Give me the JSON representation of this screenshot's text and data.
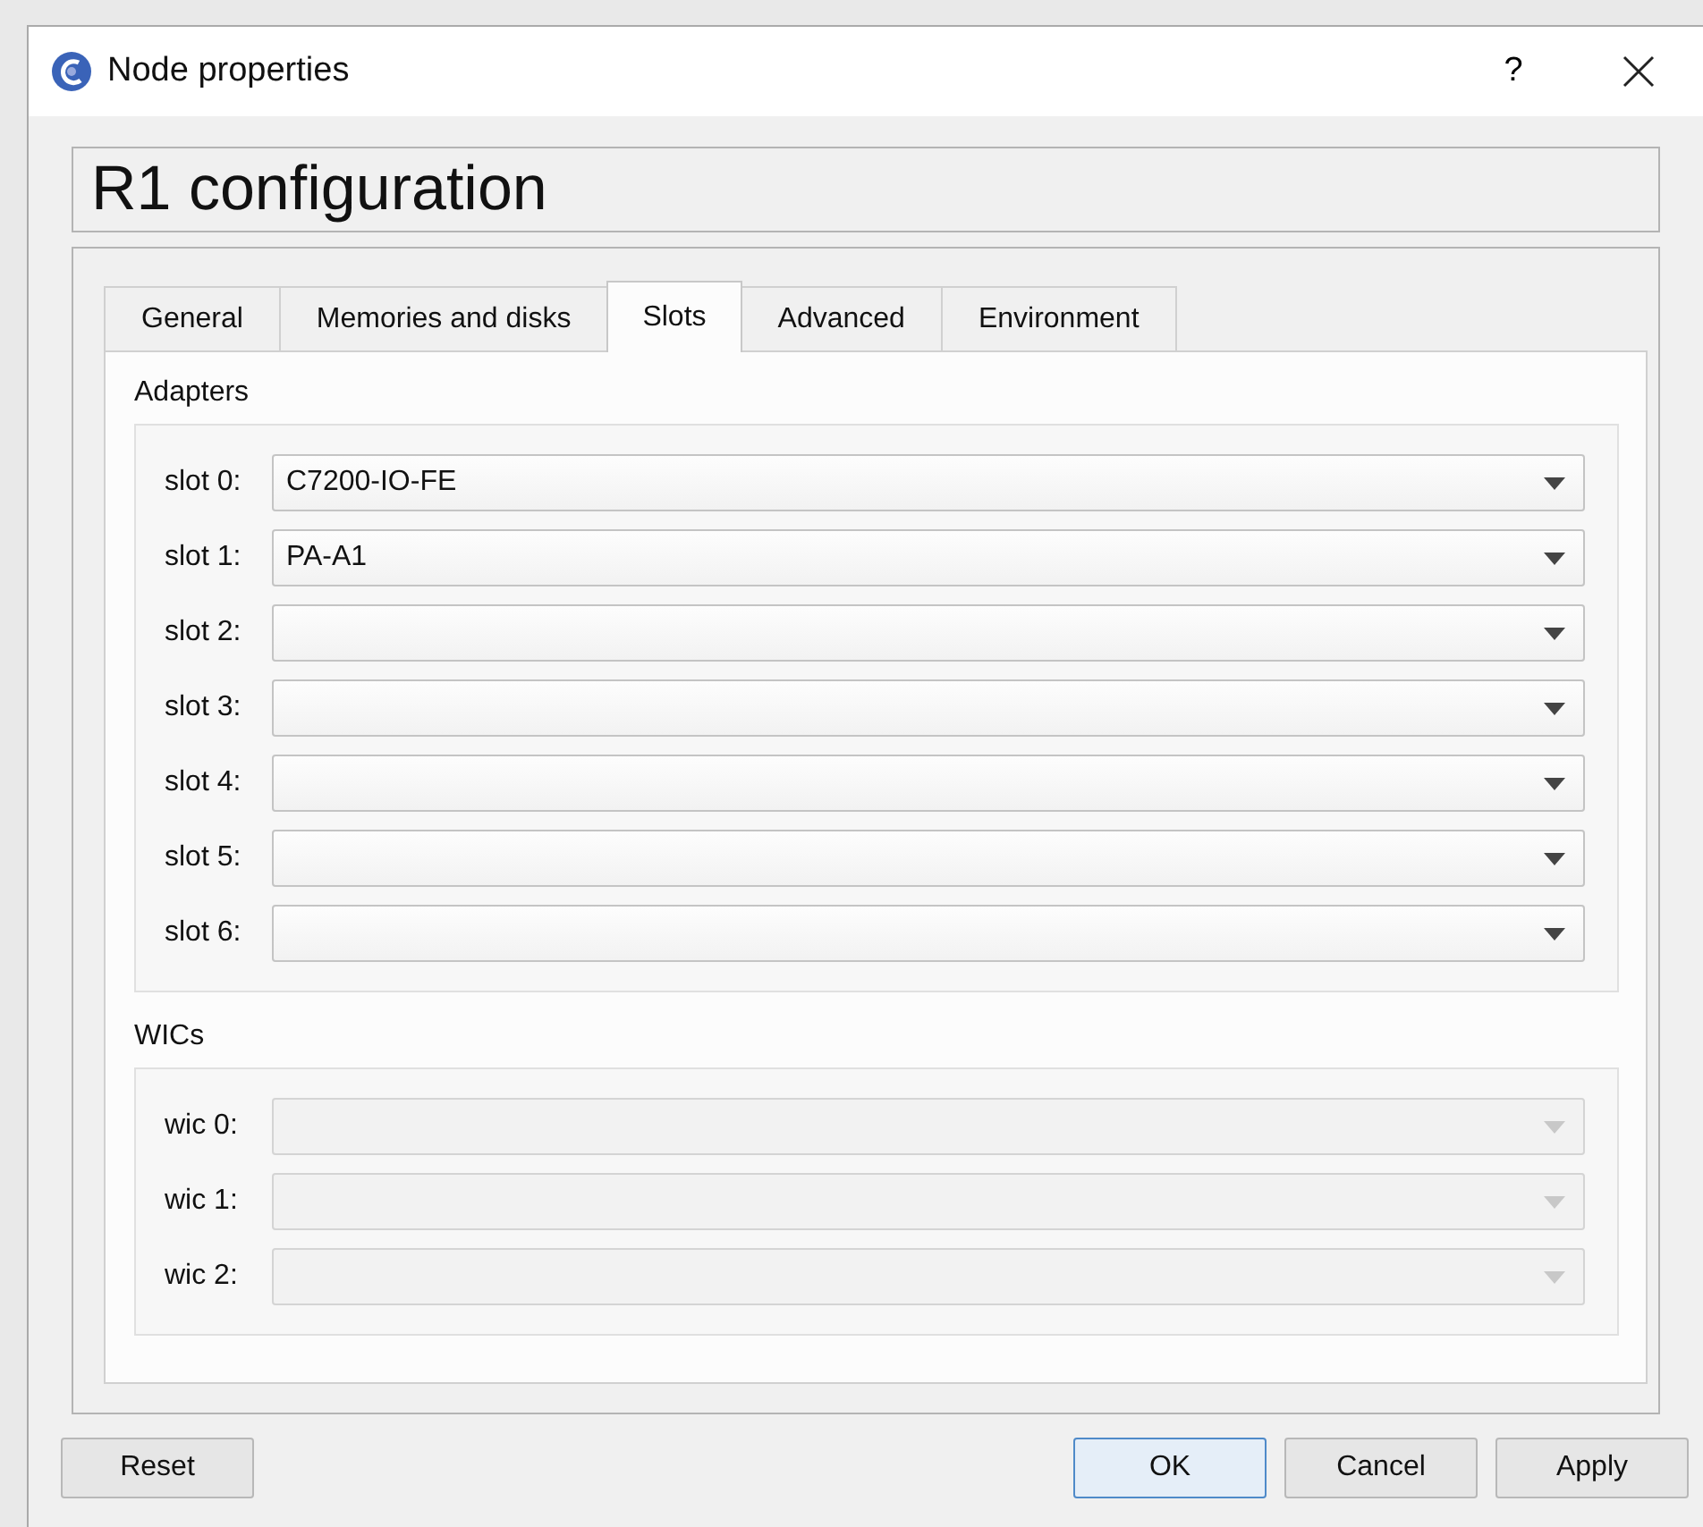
{
  "window": {
    "title": "Node properties",
    "help": "?"
  },
  "header": {
    "title": "R1 configuration"
  },
  "tabs": [
    {
      "label": "General",
      "selected": false
    },
    {
      "label": "Memories and disks",
      "selected": false
    },
    {
      "label": "Slots",
      "selected": true
    },
    {
      "label": "Advanced",
      "selected": false
    },
    {
      "label": "Environment",
      "selected": false
    }
  ],
  "groups": [
    {
      "title": "Adapters",
      "rows": [
        {
          "label": "slot 0:",
          "value": "C7200-IO-FE",
          "disabled": false
        },
        {
          "label": "slot 1:",
          "value": "PA-A1",
          "disabled": false
        },
        {
          "label": "slot 2:",
          "value": "",
          "disabled": false
        },
        {
          "label": "slot 3:",
          "value": "",
          "disabled": false
        },
        {
          "label": "slot 4:",
          "value": "",
          "disabled": false
        },
        {
          "label": "slot 5:",
          "value": "",
          "disabled": false
        },
        {
          "label": "slot 6:",
          "value": "",
          "disabled": false
        }
      ]
    },
    {
      "title": "WICs",
      "rows": [
        {
          "label": "wic 0:",
          "value": "",
          "disabled": true
        },
        {
          "label": "wic 1:",
          "value": "",
          "disabled": true
        },
        {
          "label": "wic 2:",
          "value": "",
          "disabled": true
        }
      ]
    }
  ],
  "buttons": [
    {
      "label": "Reset",
      "kind": "left",
      "default": false
    },
    {
      "label": "OK",
      "kind": "right",
      "default": true
    },
    {
      "label": "Cancel",
      "kind": "right",
      "default": false
    },
    {
      "label": "Apply",
      "kind": "right",
      "default": false
    }
  ]
}
